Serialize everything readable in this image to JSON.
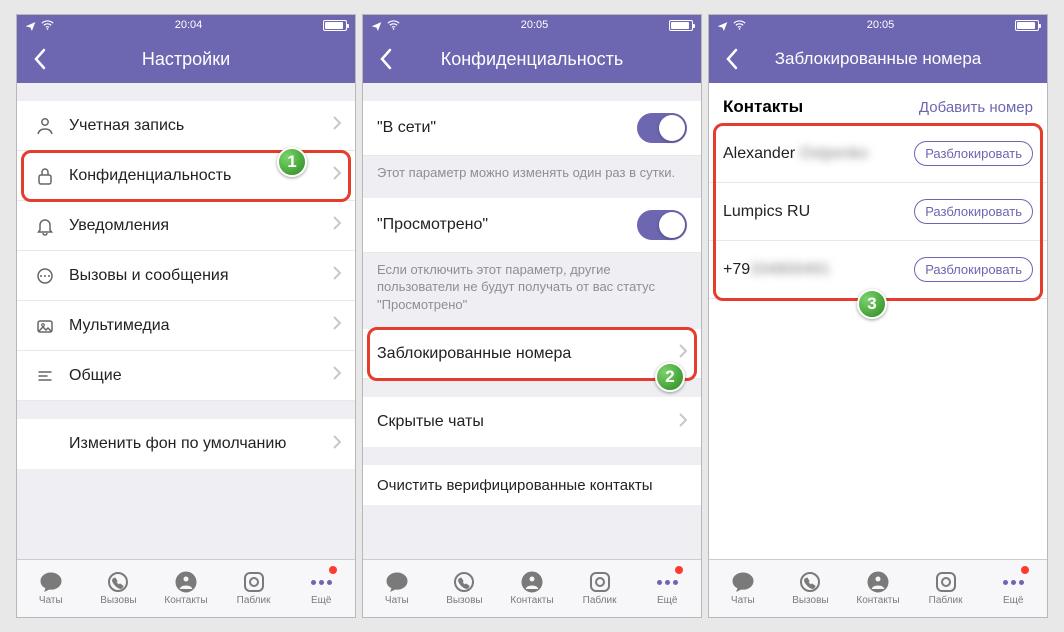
{
  "screens": [
    {
      "time": "20:04",
      "title": "Настройки",
      "settingsA": [
        {
          "icon": "user",
          "label": "Учетная запись"
        },
        {
          "icon": "lock",
          "label": "Конфиденциальность"
        },
        {
          "icon": "bell",
          "label": "Уведомления"
        },
        {
          "icon": "msg",
          "label": "Вызовы и сообщения"
        },
        {
          "icon": "media",
          "label": "Мультимедиа"
        },
        {
          "icon": "lines",
          "label": "Общие"
        }
      ],
      "extra": {
        "label": "Изменить фон по умолчанию"
      }
    },
    {
      "time": "20:05",
      "title": "Конфиденциальность",
      "opt1": {
        "label": "\"В сети\"",
        "desc": "Этот параметр можно изменять один раз в сутки."
      },
      "opt2": {
        "label": "\"Просмотрено\"",
        "desc": "Если отключить этот параметр, другие пользователи не будут получать от вас статус \"Просмотрено\""
      },
      "linkrows": [
        {
          "label": "Заблокированные номера"
        },
        {
          "label": "Скрытые чаты"
        },
        {
          "label": "Очистить верифицированные контакты"
        }
      ]
    },
    {
      "time": "20:05",
      "title": "Заблокированные номера",
      "header": {
        "h": "Контакты",
        "link": "Добавить номер"
      },
      "contacts": [
        {
          "name": "Alexander",
          "suffix": "Ostpenko",
          "btn": "Разблокировать"
        },
        {
          "name": "Lumpics RU",
          "suffix": "",
          "btn": "Разблокировать"
        },
        {
          "name": "+79",
          "suffix": "334800491",
          "btn": "Разблокировать"
        }
      ]
    }
  ],
  "tabs": [
    {
      "label": "Чаты"
    },
    {
      "label": "Вызовы"
    },
    {
      "label": "Контакты"
    },
    {
      "label": "Паблик"
    },
    {
      "label": "Ещё"
    }
  ]
}
